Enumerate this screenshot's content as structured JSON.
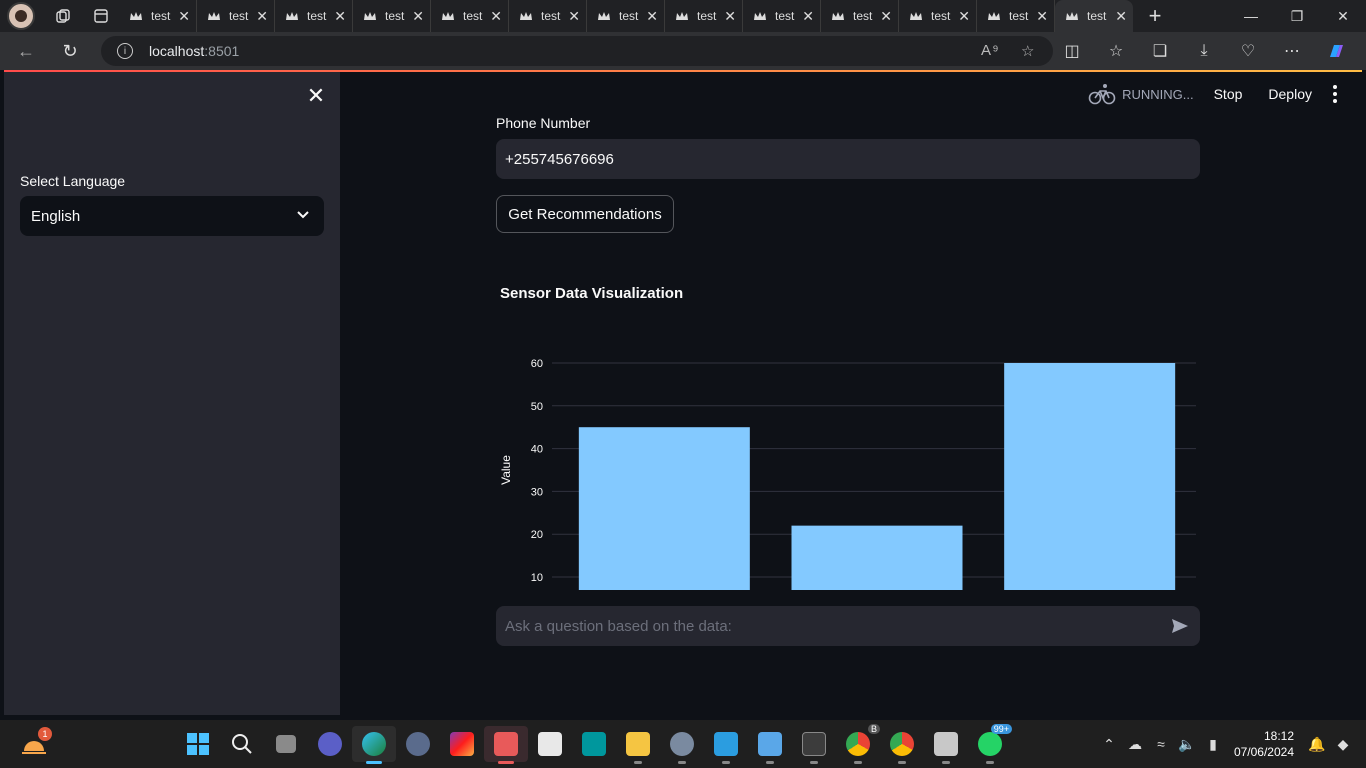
{
  "browser": {
    "tabs": [
      {
        "label": "test"
      },
      {
        "label": "test"
      },
      {
        "label": "test"
      },
      {
        "label": "test"
      },
      {
        "label": "test"
      },
      {
        "label": "test"
      },
      {
        "label": "test"
      },
      {
        "label": "test"
      },
      {
        "label": "test"
      },
      {
        "label": "test"
      },
      {
        "label": "test"
      },
      {
        "label": "test"
      },
      {
        "label": "test",
        "active": true
      }
    ],
    "url_host": "localhost",
    "url_port": ":8501"
  },
  "header": {
    "status": "RUNNING...",
    "stop_label": "Stop",
    "deploy_label": "Deploy"
  },
  "sidebar": {
    "language_label": "Select Language",
    "language_value": "English"
  },
  "main": {
    "phone_label": "Phone Number",
    "phone_value": "+255745676696",
    "recommend_button": "Get Recommendations",
    "chart_title": "Sensor Data Visualization",
    "chat_placeholder": "Ask a question based on the data:"
  },
  "chart_data": {
    "type": "bar",
    "title": "Sensor Data Visualization",
    "xlabel": "",
    "ylabel": "Value",
    "values": [
      45,
      22,
      60
    ],
    "yticks": [
      10,
      20,
      30,
      40,
      50,
      60
    ],
    "bar_color": "#83c9ff",
    "grid": true
  },
  "taskbar": {
    "weather_badge": "1",
    "time": "18:12",
    "date": "07/06/2024",
    "chrome_badge": "B",
    "whatsapp_badge": "99+"
  },
  "colors": {
    "app_bg": "#0e1117",
    "sidebar_bg": "#262730",
    "accent": "#ff4b4b",
    "bar": "#83c9ff"
  }
}
